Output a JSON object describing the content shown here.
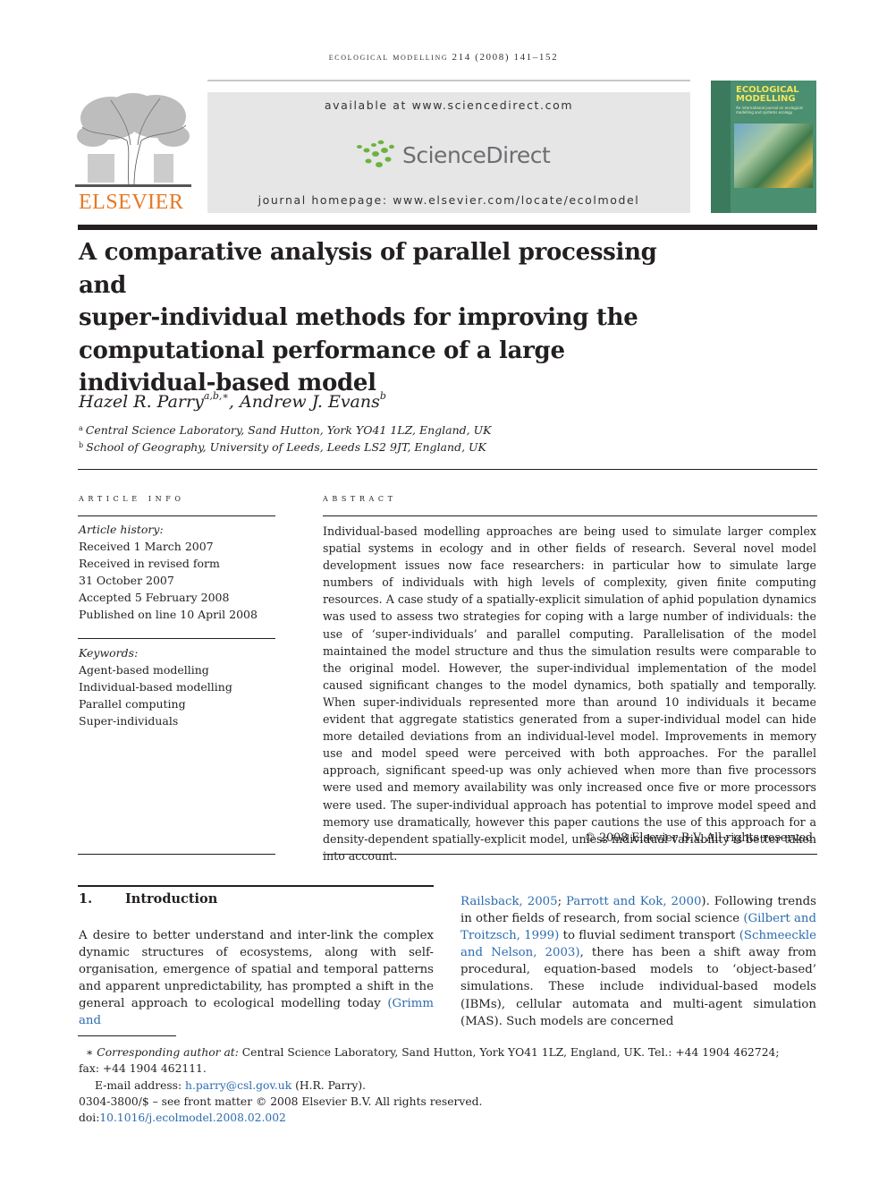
{
  "running_header": "ecological modelling 214 (2008) 141–152",
  "publisher": {
    "logo_word": "ELSEVIER",
    "logo_color": "#e87722"
  },
  "banner": {
    "available_at": "available at www.sciencedirect.com",
    "brand": "ScienceDirect",
    "brand_dots_color": "#6cb33e",
    "homepage": "journal homepage: www.elsevier.com/locate/ecolmodel"
  },
  "cover": {
    "title_lines": [
      "ECOLOGICAL",
      "MODELLING"
    ],
    "subtitle": "An international journal on ecological modelling and systems ecology"
  },
  "article": {
    "title_lines": [
      "A comparative analysis of parallel processing and",
      "super-individual methods for improving the",
      "computational performance of a large",
      "individual-based model"
    ],
    "authors": [
      {
        "name": "Hazel R. Parry",
        "sup": "a,b,∗"
      },
      {
        "name": "Andrew J. Evans",
        "sup": "b"
      }
    ],
    "author_separator": ", ",
    "affiliations": [
      {
        "mark": "a",
        "text": "Central Science Laboratory, Sand Hutton, York YO41 1LZ, England, UK"
      },
      {
        "mark": "b",
        "text": "School of Geography, University of Leeds, Leeds LS2 9JT, England, UK"
      }
    ]
  },
  "article_info": {
    "heading": "article info",
    "history_label": "Article history:",
    "history": [
      "Received 1 March 2007",
      "Received in revised form",
      "31 October 2007",
      "Accepted 5 February 2008",
      "Published on line 10 April 2008"
    ],
    "keywords_label": "Keywords:",
    "keywords": [
      "Agent-based modelling",
      "Individual-based modelling",
      "Parallel computing",
      "Super-individuals"
    ]
  },
  "abstract": {
    "heading": "abstract",
    "text": "Individual-based modelling approaches are being used to simulate larger complex spatial systems in ecology and in other fields of research. Several novel model development issues now face researchers: in particular how to simulate large numbers of individuals with high levels of complexity, given finite computing resources. A case study of a spatially-explicit simulation of aphid population dynamics was used to assess two strategies for coping with a large number of individuals: the use of ‘super-individuals’ and parallel computing. Parallelisation of the model maintained the model structure and thus the simulation results were comparable to the original model. However, the super-individual implementation of the model caused significant changes to the model dynamics, both spatially and temporally. When super-individuals represented more than around 10 individuals it became evident that aggregate statistics generated from a super-individual model can hide more detailed deviations from an individual-level model. Improvements in memory use and model speed were perceived with both approaches. For the parallel approach, significant speed-up was only achieved when more than five processors were used and memory availability was only increased once five or more processors were used. The super-individual approach has potential to improve model speed and memory use dramatically, however this paper cautions the use of this approach for a density-dependent spatially-explicit model, unless individual variability is better taken into account.",
    "copyright": "© 2008 Elsevier B.V. All rights reserved."
  },
  "introduction": {
    "number": "1.",
    "heading": "Introduction",
    "left_text_before_link": "A desire to better understand and inter-link the complex dynamic structures of ecosystems, along with self-organisation, emergence of spatial and temporal patterns and apparent unpredictability, has prompted a shift in the general approach to ecological modelling today ",
    "left_link": "(Grimm and",
    "right_segments": [
      {
        "text": "Railsback, 2005",
        "link": true
      },
      {
        "text": "; ",
        "link": false
      },
      {
        "text": "Parrott and Kok, 2000",
        "link": true
      },
      {
        "text": "). Following trends in other fields of research, from social science ",
        "link": false
      },
      {
        "text": "(Gilbert and Troitzsch, 1999)",
        "link": true
      },
      {
        "text": " to fluvial sediment transport ",
        "link": false
      },
      {
        "text": "(Schmeeckle and Nelson, 2003)",
        "link": true
      },
      {
        "text": ", there has been a shift away from procedural, equation-based models to ‘object-based’ simulations. These include individual-based models (IBMs), cellular automata and multi-agent simulation (MAS). Such models are concerned",
        "link": false
      }
    ]
  },
  "footnotes": {
    "corresponding_mark": "∗",
    "corresponding_label": "Corresponding author at:",
    "corresponding_text": " Central Science Laboratory, Sand Hutton, York YO41 1LZ, England, UK. Tel.: +44 1904 462724;",
    "fax": "fax: +44 1904 462111.",
    "email_label": "E-mail address: ",
    "email": "h.parry@csl.gov.uk",
    "email_suffix": " (H.R. Parry).",
    "front_matter": "0304-3800/$ – see front matter © 2008 Elsevier B.V. All rights reserved.",
    "doi_label": "doi:",
    "doi": "10.1016/j.ecolmodel.2008.02.002"
  },
  "colors": {
    "link": "#2b6cb0",
    "text": "#231f20",
    "banner_bg": "#e6e6e6"
  }
}
